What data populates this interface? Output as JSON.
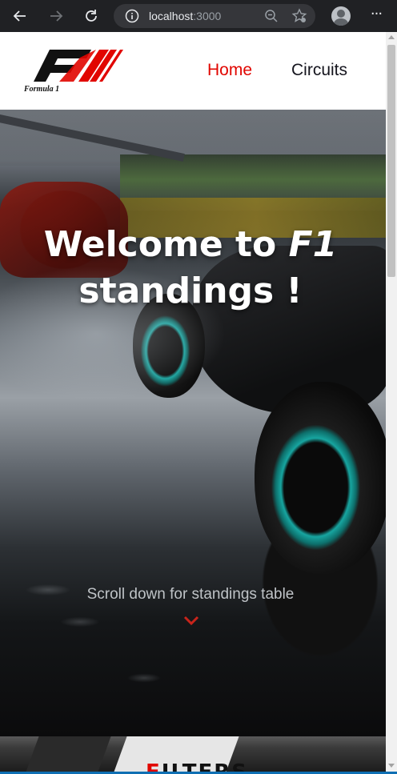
{
  "browser": {
    "url_host": "localhost",
    "url_port": ":3000",
    "icons": [
      "back-arrow-icon",
      "forward-arrow-icon",
      "refresh-icon",
      "info-icon",
      "zoom-out-icon",
      "favorite-star-icon",
      "profile-icon",
      "more-menu-icon"
    ]
  },
  "header": {
    "logo_text": "Formula 1",
    "nav": {
      "home": "Home",
      "circuits": "Circuits"
    },
    "colors": {
      "accent": "#e10600",
      "text": "#15151e"
    }
  },
  "hero": {
    "title_part1": "Welcome to ",
    "title_em": "F1",
    "title_part2": "standings !",
    "hint": "Scroll down for standings table"
  },
  "filters": {
    "title_f": "F",
    "title_rest": "ILTERS"
  }
}
